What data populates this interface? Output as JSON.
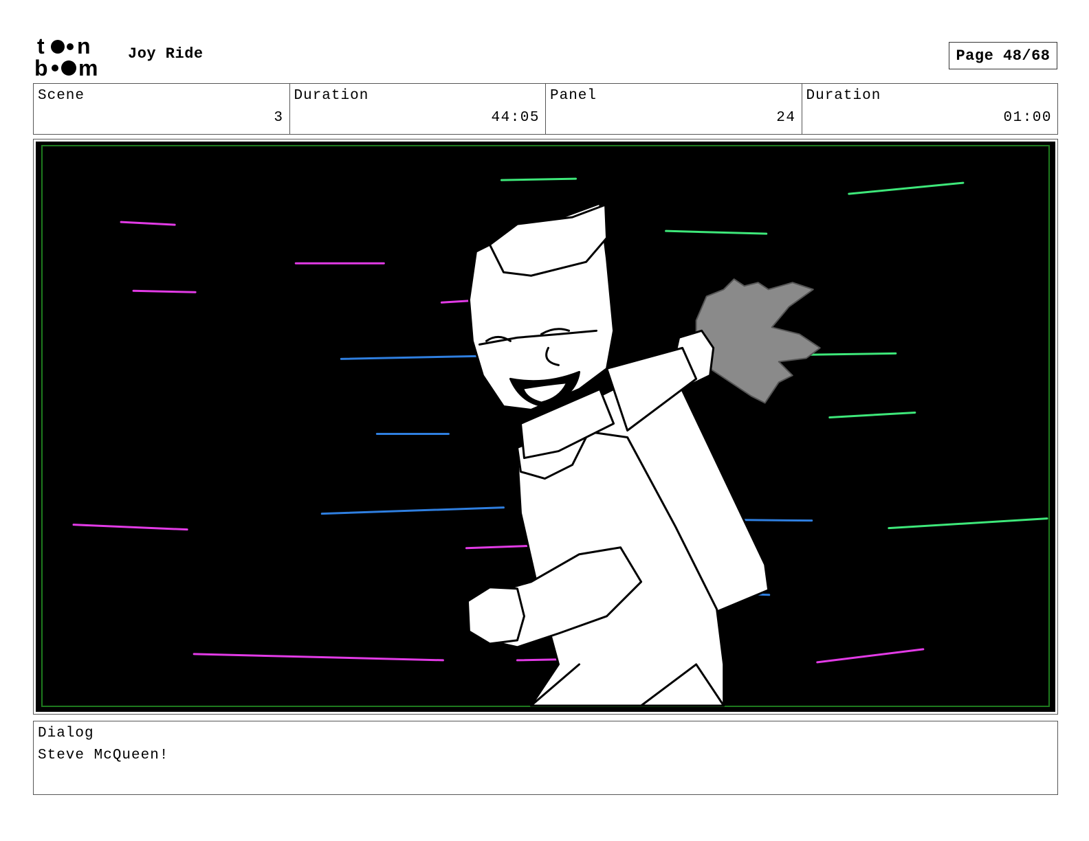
{
  "header": {
    "logo": {
      "name": "toon-boom-logo",
      "text_top": "to•n",
      "text_bottom": "b••m"
    },
    "project_title": "Joy Ride",
    "page_label": "Page 48/68"
  },
  "info": {
    "scene_label": "Scene",
    "scene_value": "3",
    "scene_duration_label": "Duration",
    "scene_duration_value": "44:05",
    "panel_label": "Panel",
    "panel_value": "24",
    "panel_duration_label": "Duration",
    "panel_duration_value": "01:00"
  },
  "panel": {
    "background_color": "#000000",
    "safe_frame_color": "#1e7a1e",
    "streak_colors": {
      "magenta": "#e23be6",
      "green": "#3ee87a",
      "blue": "#2f7fe0"
    },
    "character_fill": "#ffffff",
    "hand_fill": "#8a8a8a"
  },
  "dialog": {
    "label": "Dialog",
    "text": "Steve McQueen!"
  }
}
